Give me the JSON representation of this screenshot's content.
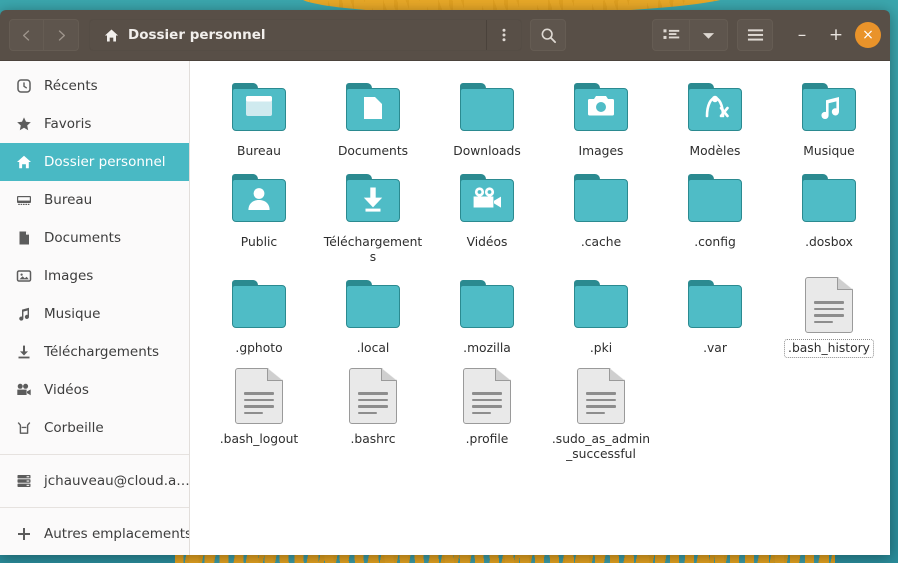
{
  "window": {
    "title": "Dossier personnel"
  },
  "headerbar": {
    "back_label": "‹",
    "forward_label": "›",
    "path_label": "Dossier personnel",
    "path_icon": "home-icon",
    "path_menu_icon": "overflow-menu-icon",
    "search_icon": "search-icon",
    "view_list_icon": "list-view-icon",
    "view_dropdown_icon": "chevron-down-icon",
    "hamburger_icon": "hamburger-menu-icon",
    "minimize_label": "–",
    "maximize_label": "+",
    "close_label": "×",
    "close_color": "#e9932a"
  },
  "sidebar": {
    "items": [
      {
        "label": "Récents",
        "icon": "clock-icon",
        "active": false
      },
      {
        "label": "Favoris",
        "icon": "star-icon",
        "active": false
      },
      {
        "label": "Dossier personnel",
        "icon": "home-icon",
        "active": true
      },
      {
        "label": "Bureau",
        "icon": "desktop-icon",
        "active": false
      },
      {
        "label": "Documents",
        "icon": "document-icon",
        "active": false
      },
      {
        "label": "Images",
        "icon": "picture-icon",
        "active": false
      },
      {
        "label": "Musique",
        "icon": "music-icon",
        "active": false
      },
      {
        "label": "Téléchargements",
        "icon": "download-icon",
        "active": false
      },
      {
        "label": "Vidéos",
        "icon": "video-icon",
        "active": false
      },
      {
        "label": "Corbeille",
        "icon": "trash-icon",
        "active": false
      }
    ],
    "mount": {
      "label": "jchauveau@cloud.a…",
      "icon": "server-icon"
    },
    "other": {
      "label": "Autres emplacements",
      "icon": "plus-icon"
    },
    "active_color": "#49b9c4"
  },
  "files": {
    "folder_color": "#4fbcc6",
    "folder_border": "#2b8a90",
    "items": [
      {
        "name": "Bureau",
        "type": "folder",
        "emblem": "desktop-emblem",
        "focused": false
      },
      {
        "name": "Documents",
        "type": "folder",
        "emblem": "document-emblem",
        "focused": false
      },
      {
        "name": "Downloads",
        "type": "folder",
        "emblem": "none",
        "focused": false
      },
      {
        "name": "Images",
        "type": "folder",
        "emblem": "camera-emblem",
        "focused": false
      },
      {
        "name": "Modèles",
        "type": "folder",
        "emblem": "template-emblem",
        "focused": false
      },
      {
        "name": "Musique",
        "type": "folder",
        "emblem": "music-emblem",
        "focused": false
      },
      {
        "name": "Public",
        "type": "folder",
        "emblem": "person-emblem",
        "focused": false
      },
      {
        "name": "Téléchargements",
        "type": "folder",
        "emblem": "download-emblem",
        "focused": false
      },
      {
        "name": "Vidéos",
        "type": "folder",
        "emblem": "camcorder-emblem",
        "focused": false
      },
      {
        "name": ".cache",
        "type": "folder",
        "emblem": "none",
        "focused": false
      },
      {
        "name": ".config",
        "type": "folder",
        "emblem": "none",
        "focused": false
      },
      {
        "name": ".dosbox",
        "type": "folder",
        "emblem": "none",
        "focused": false
      },
      {
        "name": ".gphoto",
        "type": "folder",
        "emblem": "none",
        "focused": false
      },
      {
        "name": ".local",
        "type": "folder",
        "emblem": "none",
        "focused": false
      },
      {
        "name": ".mozilla",
        "type": "folder",
        "emblem": "none",
        "focused": false
      },
      {
        "name": ".pki",
        "type": "folder",
        "emblem": "none",
        "focused": false
      },
      {
        "name": ".var",
        "type": "folder",
        "emblem": "none",
        "focused": false
      },
      {
        "name": ".bash_history",
        "type": "file",
        "emblem": "none",
        "focused": true
      },
      {
        "name": ".bash_logout",
        "type": "file",
        "emblem": "none",
        "focused": false
      },
      {
        "name": ".bashrc",
        "type": "file",
        "emblem": "none",
        "focused": false
      },
      {
        "name": ".profile",
        "type": "file",
        "emblem": "none",
        "focused": false
      },
      {
        "name": ".sudo_as_admin_successful",
        "type": "file",
        "emblem": "none",
        "focused": false
      }
    ]
  }
}
